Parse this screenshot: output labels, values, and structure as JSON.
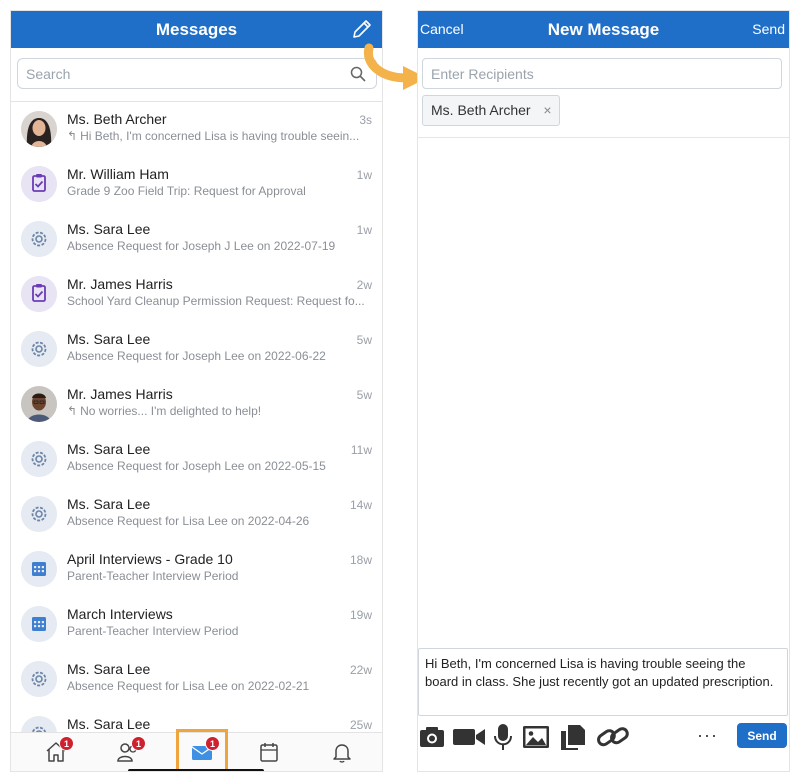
{
  "inbox": {
    "title": "Messages",
    "search_placeholder": "Search",
    "messages": [
      {
        "name": "Ms. Beth Archer",
        "preview": "Hi Beth, I'm concerned Lisa is having trouble seein...",
        "time": "3s",
        "reply": true,
        "avatar": "photo-woman"
      },
      {
        "name": "Mr. William Ham",
        "preview": "Grade 9 Zoo Field Trip: Request for Approval",
        "time": "1w",
        "reply": false,
        "avatar": "clipboard-check-icon"
      },
      {
        "name": "Ms. Sara Lee",
        "preview": "Absence Request for Joseph J Lee on 2022-07-19",
        "time": "1w",
        "reply": false,
        "avatar": "gear-icon"
      },
      {
        "name": "Mr. James Harris",
        "preview": "School Yard Cleanup Permission Request: Request fo...",
        "time": "2w",
        "reply": false,
        "avatar": "clipboard-check-icon"
      },
      {
        "name": "Ms. Sara Lee",
        "preview": "Absence Request for Joseph Lee on 2022-06-22",
        "time": "5w",
        "reply": false,
        "avatar": "gear-icon"
      },
      {
        "name": "Mr. James Harris",
        "preview": "No worries... I'm delighted to help!",
        "time": "5w",
        "reply": true,
        "avatar": "photo-man"
      },
      {
        "name": "Ms. Sara Lee",
        "preview": "Absence Request for Joseph Lee on 2022-05-15",
        "time": "11w",
        "reply": false,
        "avatar": "gear-icon"
      },
      {
        "name": "Ms. Sara Lee",
        "preview": "Absence Request for Lisa Lee on 2022-04-26",
        "time": "14w",
        "reply": false,
        "avatar": "gear-icon"
      },
      {
        "name": "April Interviews - Grade 10",
        "preview": "Parent-Teacher Interview Period",
        "time": "18w",
        "reply": false,
        "avatar": "calendar-grid-icon"
      },
      {
        "name": "March Interviews",
        "preview": "Parent-Teacher Interview Period",
        "time": "19w",
        "reply": false,
        "avatar": "calendar-grid-icon"
      },
      {
        "name": "Ms. Sara Lee",
        "preview": "Absence Request for Lisa Lee on 2022-02-21",
        "time": "22w",
        "reply": false,
        "avatar": "gear-icon"
      },
      {
        "name": "Ms. Sara Lee",
        "preview": "",
        "time": "25w",
        "reply": false,
        "avatar": "gear-icon"
      }
    ],
    "tabs": [
      {
        "icon": "home-icon",
        "badge": "1"
      },
      {
        "icon": "people-icon",
        "badge": "1"
      },
      {
        "icon": "mail-icon",
        "badge": "1",
        "active": true
      },
      {
        "icon": "calendar-icon",
        "badge": ""
      },
      {
        "icon": "bell-icon",
        "badge": ""
      }
    ]
  },
  "compose": {
    "cancel_label": "Cancel",
    "title": "New Message",
    "send_label": "Send",
    "recipients_placeholder": "Enter Recipients",
    "recipient_chip": "Ms. Beth Archer",
    "chip_remove": "×",
    "body": "Hi Beth, I'm concerned Lisa is having trouble seeing the board in class. She just recently got an updated prescription.",
    "more_label": "···",
    "send_button_label": "Send"
  },
  "colors": {
    "header_blue": "#1f6fc8",
    "badge_red": "#d0202e",
    "highlight_orange": "#f0a43c",
    "arrow_orange": "#f3b24a"
  }
}
